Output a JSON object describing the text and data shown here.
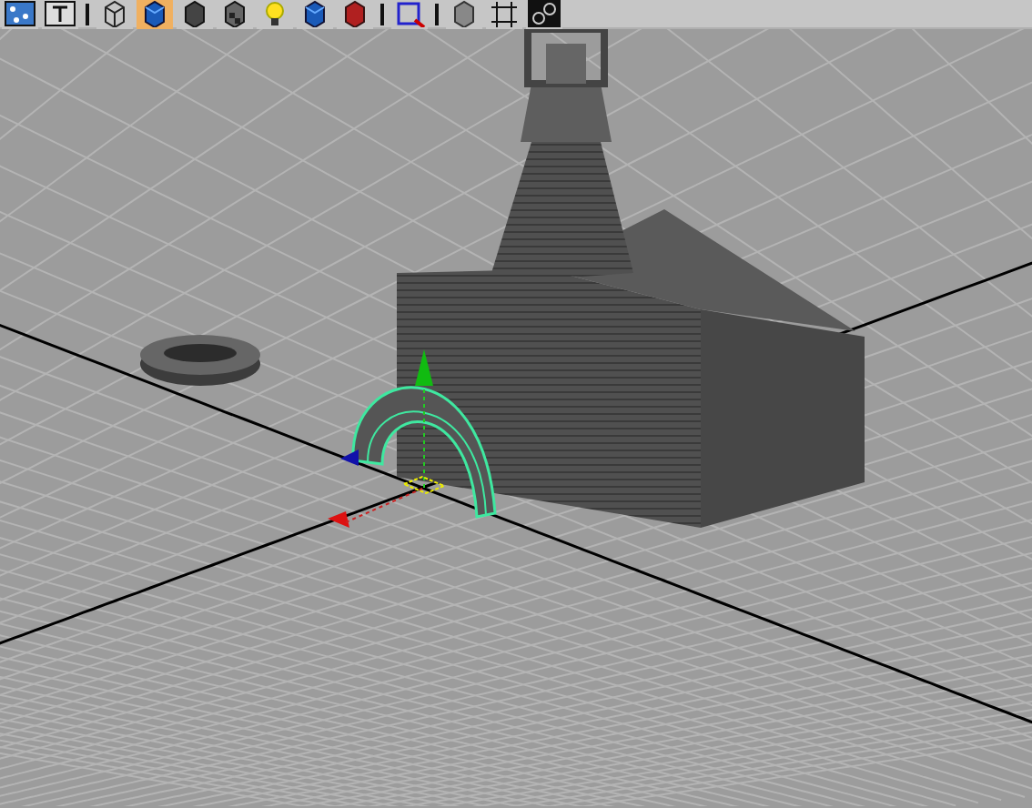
{
  "toolbar": {
    "buttons": [
      {
        "kind": "grid",
        "selected": false
      },
      {
        "kind": "text",
        "selected": false
      },
      {
        "kind": "separator",
        "selected": false
      },
      {
        "kind": "wire-cube",
        "selected": false
      },
      {
        "kind": "blue-cube",
        "selected": true
      },
      {
        "kind": "dark-cube",
        "selected": false
      },
      {
        "kind": "checker-cube",
        "selected": false
      },
      {
        "kind": "bulb",
        "selected": false
      },
      {
        "kind": "blue-cube",
        "selected": false
      },
      {
        "kind": "red-cube",
        "selected": false
      },
      {
        "kind": "separator",
        "selected": false
      },
      {
        "kind": "select-square",
        "selected": false
      },
      {
        "kind": "separator",
        "selected": false
      },
      {
        "kind": "gray-cube",
        "selected": false
      },
      {
        "kind": "frame",
        "selected": false
      },
      {
        "kind": "chain",
        "selected": false
      }
    ]
  }
}
